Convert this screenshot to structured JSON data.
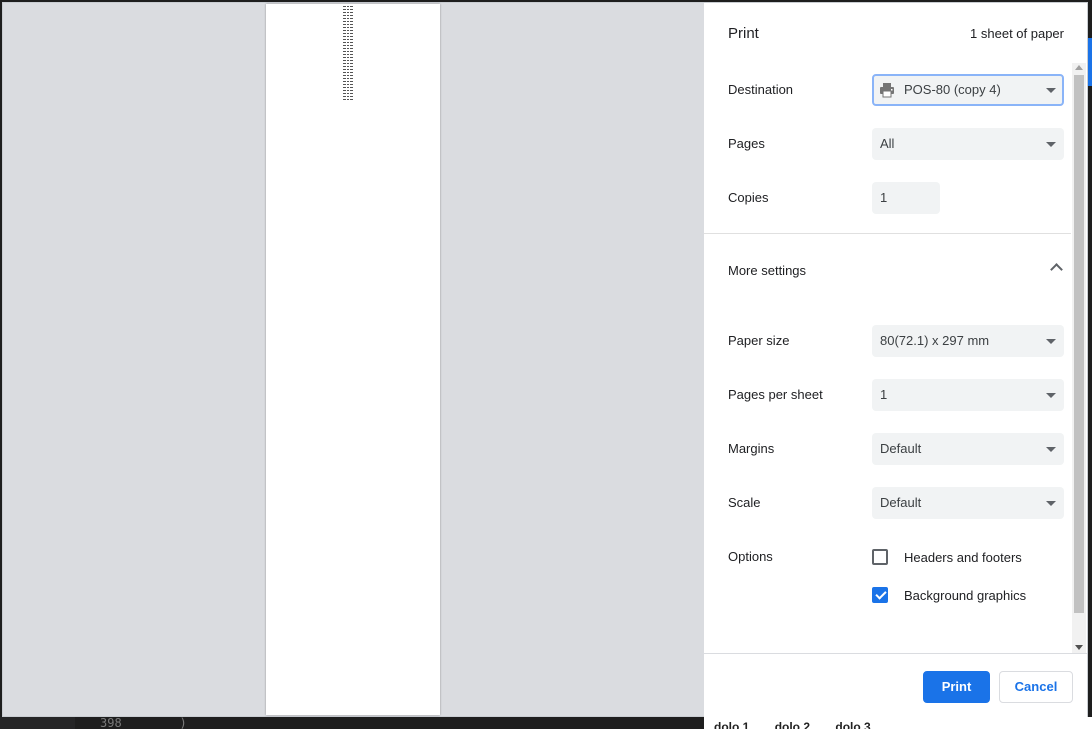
{
  "background": {
    "code_line_number": "398",
    "code_fragment": ")",
    "right_tabs": [
      "dolo 1",
      "dolo 2",
      "dolo 3"
    ]
  },
  "dialog": {
    "title": "Print",
    "sheet_count": "1 sheet of paper",
    "settings": {
      "destination": {
        "label": "Destination",
        "value": "POS-80 (copy 4)",
        "icon": "printer-icon"
      },
      "pages": {
        "label": "Pages",
        "value": "All"
      },
      "copies": {
        "label": "Copies",
        "value": "1"
      },
      "more_settings": {
        "label": "More settings",
        "expanded": true
      },
      "paper_size": {
        "label": "Paper size",
        "value": "80(72.1) x 297 mm"
      },
      "pages_per_sheet": {
        "label": "Pages per sheet",
        "value": "1"
      },
      "margins": {
        "label": "Margins",
        "value": "Default"
      },
      "scale": {
        "label": "Scale",
        "value": "Default"
      },
      "options": {
        "label": "Options",
        "headers_footers": {
          "label": "Headers and footers",
          "checked": false
        },
        "background_graphics": {
          "label": "Background graphics",
          "checked": true
        }
      }
    },
    "buttons": {
      "print": "Print",
      "cancel": "Cancel"
    }
  },
  "colors": {
    "accent": "#1a73e8",
    "preview_bg": "#dadce0",
    "select_bg": "#f1f3f4"
  }
}
